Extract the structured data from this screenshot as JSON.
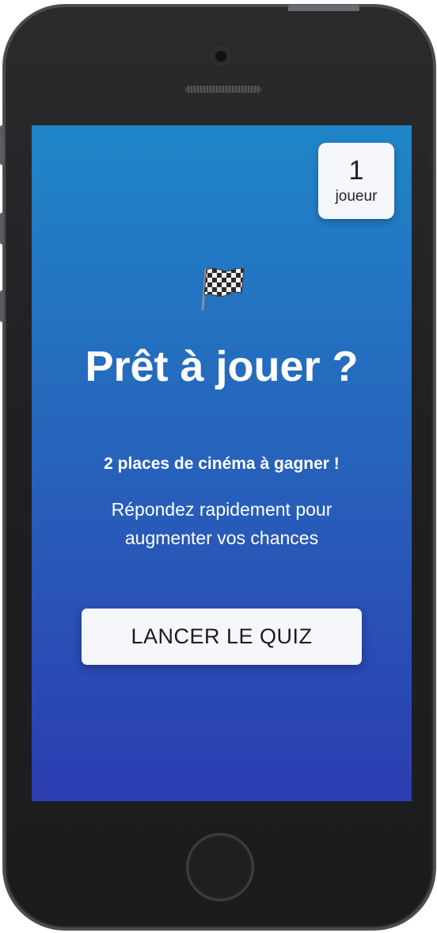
{
  "device": {
    "type": "smartphone"
  },
  "player_badge": {
    "count": "1",
    "label": "joueur"
  },
  "main": {
    "flag_icon": "checkered-flag-icon",
    "title": "Prêt à jouer ?",
    "prize": "2 places de cinéma à gagner !",
    "description": "Répondez rapidement pour augmenter vos chances",
    "start_button_label": "LANCER LE QUIZ"
  },
  "colors": {
    "screen_gradient_top": "#1f86c8",
    "screen_gradient_bottom": "#2b3cb1",
    "card_background": "#f6f7fa",
    "text_light": "#ffffff",
    "text_dark": "#1b1b1f"
  }
}
